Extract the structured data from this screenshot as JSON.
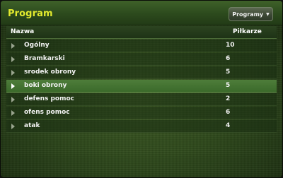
{
  "header": {
    "title": "Program",
    "button_label": "Programy"
  },
  "table": {
    "columns": {
      "name": "Nazwa",
      "count": "Piłkarze"
    },
    "selected_index": 4,
    "rows": [
      {
        "name": "Ogólny",
        "count": "10"
      },
      {
        "name": "Bramkarski",
        "count": "6"
      },
      {
        "name": "srodek obrony",
        "count": "5"
      },
      {
        "name": "boki obrony",
        "count": "5"
      },
      {
        "name": "defens pomoc",
        "count": "2"
      },
      {
        "name": "ofens pomoc",
        "count": "6"
      },
      {
        "name": "atak",
        "count": "4"
      }
    ]
  },
  "colors": {
    "title": "#e3ea2e",
    "selected_row": "#4e7d3a",
    "background": "#2f4a1c"
  },
  "icons": {
    "row_expand": "triangle-right-icon",
    "dropdown": "caret-down-icon"
  }
}
